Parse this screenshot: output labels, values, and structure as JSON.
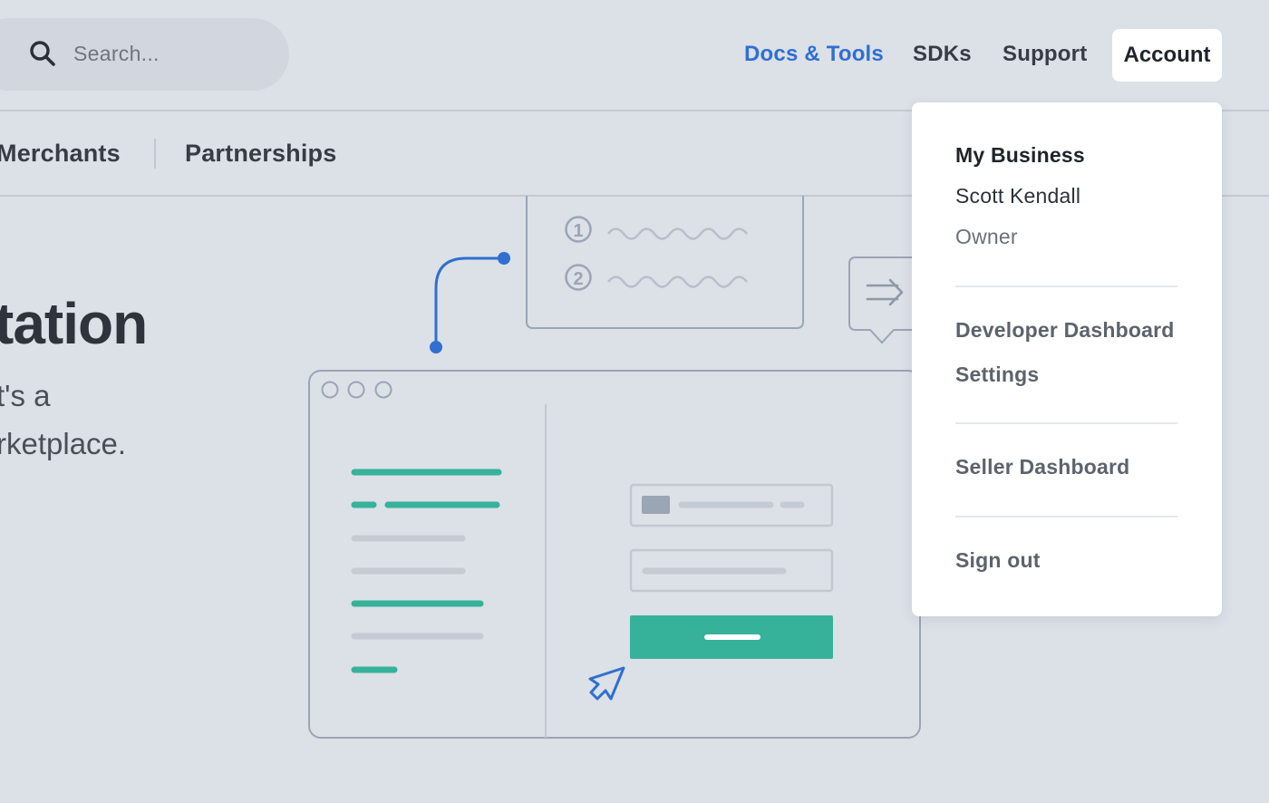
{
  "header": {
    "search_placeholder": "Search...",
    "nav": {
      "docs_tools": "Docs & Tools",
      "sdks": "SDKs",
      "support": "Support",
      "account": "Account"
    }
  },
  "subnav": {
    "merchants": "Merchants",
    "partnerships": "Partnerships"
  },
  "hero": {
    "title": "tation",
    "line1": "t's a",
    "line2": "rketplace."
  },
  "illustration": {
    "step1": "1",
    "step2": "2"
  },
  "account_menu": {
    "business": "My Business",
    "user_name": "Scott Kendall",
    "role": "Owner",
    "developer_dashboard": "Developer Dashboard",
    "settings": "Settings",
    "seller_dashboard": "Seller Dashboard",
    "sign_out": "Sign out"
  },
  "colors": {
    "background": "#dce0e7",
    "link_blue": "#2f6fd0",
    "accent_green": "#36b29a",
    "menu_bg": "#ffffff"
  }
}
